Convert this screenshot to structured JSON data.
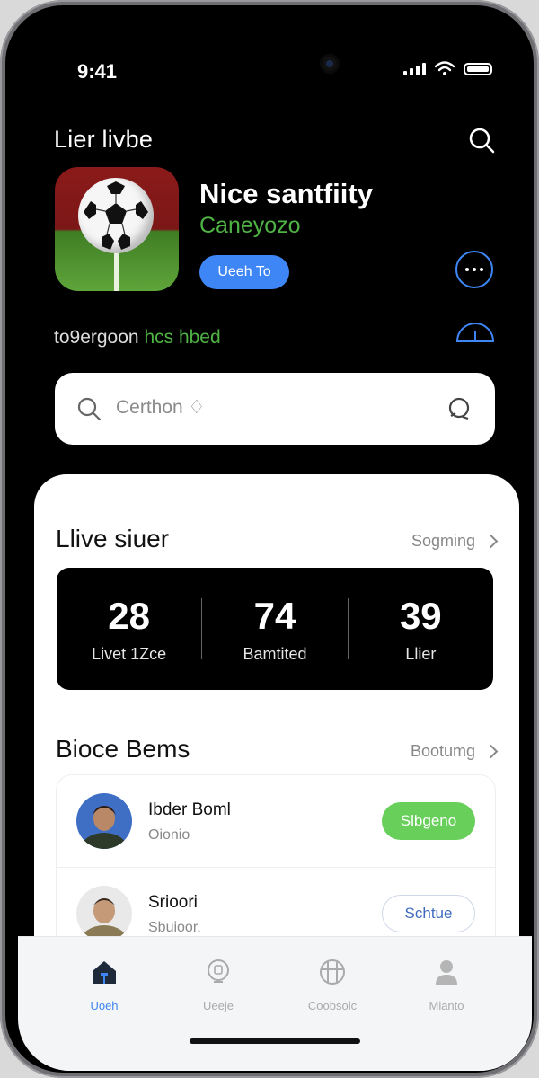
{
  "status_bar": {
    "time": "9:41"
  },
  "header": {
    "title": "Lier livbe"
  },
  "hero": {
    "name": "Nice santfiity",
    "subtitle": "Caneyozo",
    "primary_button": "Ueeh To"
  },
  "tagline": {
    "part1": "to9ergoon",
    "part2": "hcs hbed"
  },
  "search": {
    "placeholder": "Certhon ♢"
  },
  "live_section": {
    "title": "Llive siuer",
    "link": "Sogming"
  },
  "stats": [
    {
      "value": "28",
      "label": "Livet 1Zce"
    },
    {
      "value": "74",
      "label": "Bamtited"
    },
    {
      "value": "39",
      "label": "Llier"
    }
  ],
  "list_section": {
    "title": "Bioce Bems",
    "link": "Bootumg"
  },
  "list": [
    {
      "name": "Ibder Boml",
      "meta": "Oionio",
      "action": "Slbgeno",
      "action_style": "filled"
    },
    {
      "name": "Srioori",
      "meta": "Sbuioor,",
      "action": "Schtue",
      "action_style": "outline"
    }
  ],
  "tabs": [
    {
      "label": "Uoeh",
      "icon": "home-icon",
      "active": true
    },
    {
      "label": "Ueeje",
      "icon": "badge-icon",
      "active": false
    },
    {
      "label": "Coobsolc",
      "icon": "stadium-icon",
      "active": false
    },
    {
      "label": "Mianto",
      "icon": "profile-icon",
      "active": false
    }
  ],
  "colors": {
    "accent": "#3e86f5",
    "green": "#4fb244",
    "pill_green": "#68cf5a",
    "background": "#000000",
    "card": "#ffffff"
  }
}
